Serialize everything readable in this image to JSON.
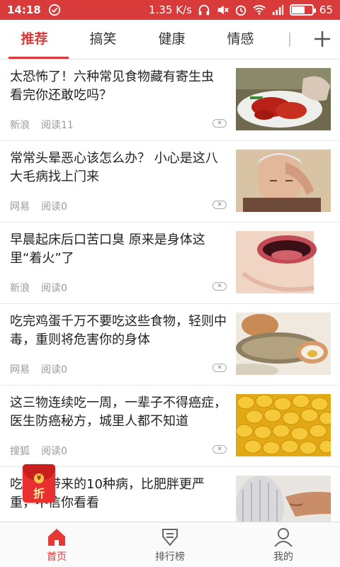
{
  "status": {
    "time": "14:18",
    "speed": "1.35 K/s",
    "battery": "65",
    "icons": [
      "check-circle-icon",
      "headphones-icon",
      "mute-icon",
      "alarm-icon",
      "wifi-icon",
      "signal-icon",
      "battery-icon"
    ],
    "bg_color": "#d93b3b"
  },
  "tabs": [
    {
      "label": "推荐",
      "active": true
    },
    {
      "label": "搞笑"
    },
    {
      "label": "健康"
    },
    {
      "label": "情感"
    }
  ],
  "tabs_accent": "#d93b3b",
  "feed": [
    {
      "title": "太恐怖了！六种常见食物藏有寄生虫 看完你还敢吃吗？",
      "source": "新浪",
      "reads": "阅读11",
      "thumb": "crayfish-dish-image"
    },
    {
      "title": "常常头晕恶心该怎么办？ 小心是这八大毛病找上门来",
      "source": "网易",
      "reads": "阅读0",
      "thumb": "man-headache-image"
    },
    {
      "title": "早晨起床后口苦口臭 原来是身体这里“着火”了",
      "source": "新浪",
      "reads": "阅读0",
      "thumb": "open-mouth-image"
    },
    {
      "title": "吃完鸡蛋千万不要吃这些食物，轻则中毒，重则将危害你的身体",
      "source": "网易",
      "reads": "阅读0",
      "thumb": "eggs-grain-image"
    },
    {
      "title": "这三物连续吃一周，一辈子不得癌症，医生防癌秘方，城里人都不知道",
      "source": "搜狐",
      "reads": "阅读0",
      "thumb": "corn-kernels-image"
    },
    {
      "title": "吃太饱带来的10种病，比肥胖更严重，不信你看看",
      "source": "",
      "reads": "",
      "thumb": "belly-image"
    }
  ],
  "red_packet": {
    "label": "折",
    "coin": "¥"
  },
  "bottom_nav": [
    {
      "label": "首页",
      "icon": "home-icon",
      "active": true
    },
    {
      "label": "排行榜",
      "icon": "ranking-icon"
    },
    {
      "label": "我的",
      "icon": "profile-icon"
    }
  ]
}
